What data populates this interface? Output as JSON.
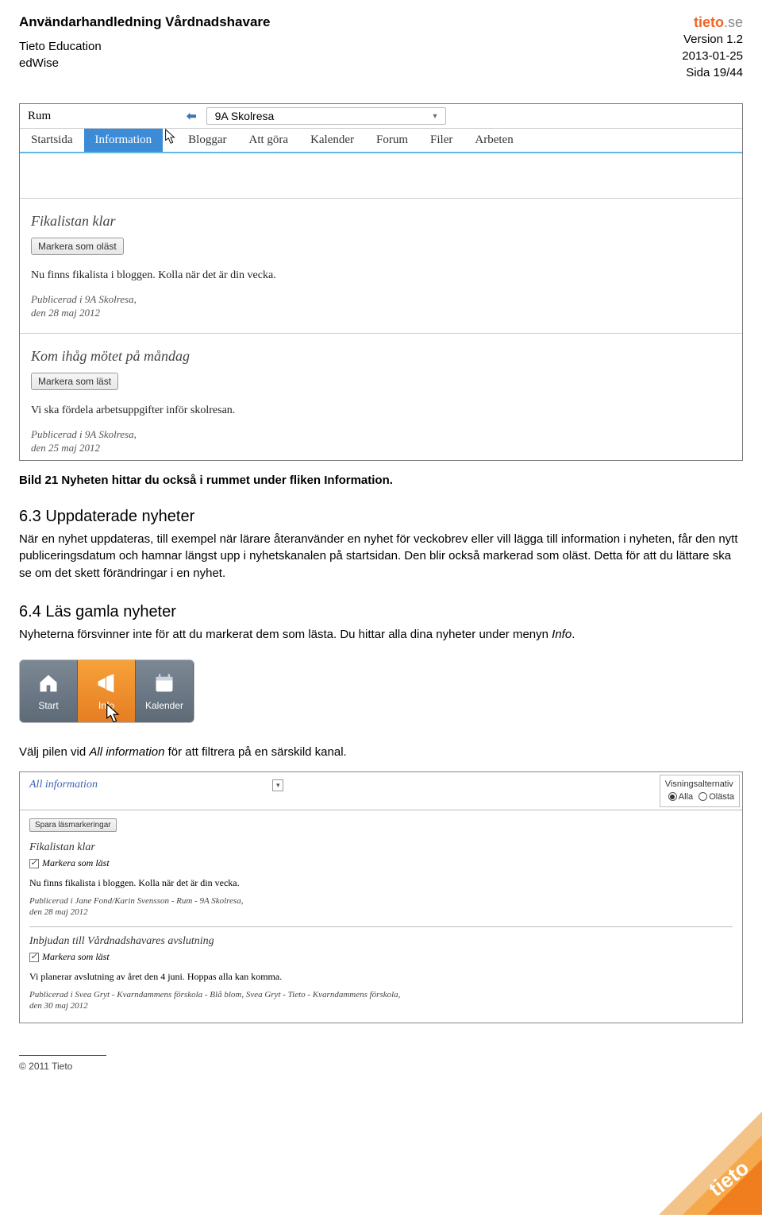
{
  "header": {
    "title": "Användarhandledning Vårdnadshavare",
    "left_line1": "Tieto Education",
    "left_line2": "edWise",
    "right_version": "Version 1.2",
    "right_date": "2013-01-25",
    "right_page": "Sida 19/44",
    "brand_main": "tieto",
    "brand_domain": ".se"
  },
  "shot1": {
    "room_label": "Rum",
    "select_value": "9A Skolresa",
    "tabs": [
      "Startsida",
      "Information",
      "Bloggar",
      "Att göra",
      "Kalender",
      "Forum",
      "Filer",
      "Arbeten"
    ],
    "item1": {
      "title": "Fikalistan klar",
      "btn": "Markera som oläst",
      "body": "Nu finns fikalista i bloggen. Kolla när det är din vecka.",
      "pub1": "Publicerad i 9A Skolresa,",
      "pub2": "den 28 maj 2012"
    },
    "item2": {
      "title": "Kom ihåg mötet på måndag",
      "btn": "Markera som läst",
      "body": "Vi ska fördela arbetsuppgifter inför skolresan.",
      "pub1": "Publicerad i 9A Skolresa,",
      "pub2": "den 25 maj 2012"
    }
  },
  "caption": "Bild 21 Nyheten hittar du också i rummet under fliken Information.",
  "section63": {
    "heading": "6.3 Uppdaterade nyheter",
    "para": "När en nyhet uppdateras, till exempel när lärare återanvänder en nyhet för veckobrev eller vill lägga till information i nyheten, får den nytt publiceringsdatum och hamnar längst upp i nyhetskanalen på startsidan. Den blir också markerad som oläst. Detta för att du lättare ska se om det skett förändringar i en nyhet."
  },
  "section64": {
    "heading": "6.4 Läs gamla nyheter",
    "para_a": "Nyheterna försvinner inte för att du markerat dem som lästa. Du hittar alla dina nyheter under menyn ",
    "para_b": "Info",
    "para_c": "."
  },
  "iconstrip": {
    "items": [
      {
        "label": "Start"
      },
      {
        "label": "Info"
      },
      {
        "label": "Kalender"
      }
    ]
  },
  "filter_a": "Välj pilen vid ",
  "filter_b": "All information",
  "filter_c": " för att filtrera på en särskild kanal.",
  "shot3": {
    "all_info": "All information",
    "visn_title": "Visningsalternativ",
    "visn_opt1": "Alla",
    "visn_opt2": "Olästa",
    "save": "Spara läsmarkeringar",
    "e1": {
      "title": "Fikalistan klar",
      "chk": "Markera som läst",
      "body": "Nu finns fikalista i bloggen. Kolla när det är din vecka.",
      "pub1": "Publicerad i Jane Fond/Karin Svensson - Rum - 9A Skolresa,",
      "pub2": "den 28 maj 2012"
    },
    "e2": {
      "title": "Inbjudan till Vårdnadshavares avslutning",
      "chk": "Markera som läst",
      "body": "Vi planerar avslutning av året den 4 juni. Hoppas alla kan komma.",
      "pub1": "Publicerad i Svea Gryt - Kvarndammens förskola - Blå blom, Svea Gryt - Tieto - Kvarndammens förskola,",
      "pub2": "den 30 maj 2012"
    }
  },
  "footer": {
    "copy": "© 2011 Tieto"
  }
}
